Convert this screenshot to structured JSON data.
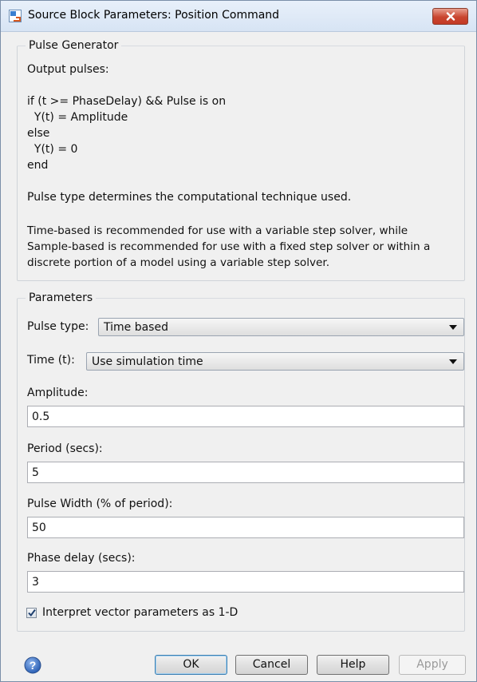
{
  "window": {
    "title": "Source Block Parameters: Position Command"
  },
  "description_group": {
    "legend": "Pulse Generator",
    "lines": [
      "Output pulses:",
      "if (t >= PhaseDelay) && Pulse is on",
      "  Y(t) = Amplitude",
      "else",
      "  Y(t) = 0",
      "end",
      "Pulse type determines the computational technique used.",
      "Time-based is recommended for use with a variable step solver, while",
      "Sample-based is recommended for use with a fixed step solver or within a",
      "discrete portion of a model using a variable step solver."
    ]
  },
  "parameters_group": {
    "legend": "Parameters",
    "pulse_type": {
      "label": "Pulse type:",
      "value": "Time based"
    },
    "time": {
      "label": "Time (t):",
      "value": "Use simulation time"
    },
    "amplitude": {
      "label": "Amplitude:",
      "value": "0.5"
    },
    "period": {
      "label": "Period (secs):",
      "value": "5"
    },
    "pulse_width": {
      "label": "Pulse Width (% of period):",
      "value": "50"
    },
    "phase_delay": {
      "label": "Phase delay (secs):",
      "value": "3"
    },
    "interpret_vector": {
      "label": "Interpret vector parameters as 1-D",
      "checked": true
    }
  },
  "buttons": {
    "ok": "OK",
    "cancel": "Cancel",
    "help": "Help",
    "apply": "Apply"
  },
  "icons": {
    "app": "simulink-block-icon",
    "close": "close-icon",
    "help": "help-question-icon"
  },
  "colors": {
    "close_button": "#c9452f",
    "default_button_border": "#3c7fb1"
  }
}
